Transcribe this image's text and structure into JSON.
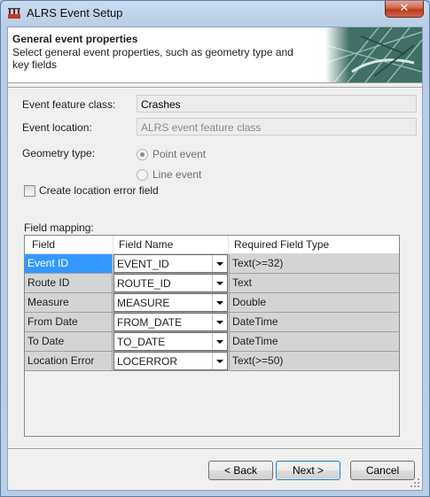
{
  "window": {
    "title": "ALRS Event Setup",
    "close_glyph": "✕",
    "app_icon": "alrs-app-icon"
  },
  "header": {
    "title": "General event properties",
    "subtitle": "Select general event properties, such as geometry type and key fields"
  },
  "form": {
    "event_feature_class_label": "Event feature class:",
    "event_feature_class_value": "Crashes",
    "event_location_label": "Event location:",
    "event_location_value": "ALRS event feature class",
    "geometry_type_label": "Geometry type:",
    "geometry_options": [
      {
        "label": "Point event",
        "selected": true
      },
      {
        "label": "Line event",
        "selected": false
      }
    ],
    "create_error_field_label": "Create location error field",
    "create_error_field_checked": false
  },
  "field_mapping": {
    "label": "Field mapping:",
    "columns": [
      "Field",
      "Field Name",
      "Required Field Type"
    ],
    "rows": [
      {
        "field": "Event ID",
        "field_name": "EVENT_ID",
        "required_type": "Text(>=32)",
        "selected": true
      },
      {
        "field": "Route ID",
        "field_name": "ROUTE_ID",
        "required_type": "Text",
        "selected": false
      },
      {
        "field": "Measure",
        "field_name": "MEASURE",
        "required_type": "Double",
        "selected": false
      },
      {
        "field": "From Date",
        "field_name": "FROM_DATE",
        "required_type": "DateTime",
        "selected": false
      },
      {
        "field": "To Date",
        "field_name": "TO_DATE",
        "required_type": "DateTime",
        "selected": false
      },
      {
        "field": "Location Error",
        "field_name": "LOCERROR",
        "required_type": "Text(>=50)",
        "selected": false
      }
    ]
  },
  "buttons": {
    "back": "< Back",
    "next": "Next >",
    "cancel": "Cancel"
  },
  "colors": {
    "selection": "#3399ff",
    "row_bg": "#d4d4d4",
    "title_bar": "#b9cfe7"
  }
}
